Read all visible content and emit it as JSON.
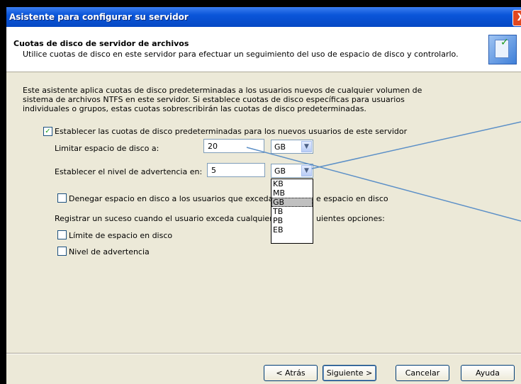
{
  "window": {
    "title": "Asistente para configurar su servidor",
    "close_label": "X"
  },
  "header": {
    "title": "Cuotas de disco de servidor de archivos",
    "subtitle": "Utilice cuotas de disco en este servidor para efectuar un seguimiento del uso de espacio de disco y controlarlo."
  },
  "intro": {
    "line1": "Este asistente aplica cuotas de disco predeterminadas a los usuarios nuevos de cualquier volumen de",
    "line2": "sistema de archivos NTFS en este servidor. Si establece cuotas de disco específicas para usuarios",
    "line3": "individuales o grupos, estas cuotas sobrescribirán las cuotas de disco predeterminadas."
  },
  "set_default_checkbox": {
    "label": "Establecer las cuotas de disco predeterminadas para los nuevos usuarios de este servidor",
    "checked": true
  },
  "limit": {
    "label": "Limitar espacio de disco a:",
    "value": "20",
    "unit": "GB"
  },
  "warning": {
    "label": "Establecer el nivel de advertencia en:",
    "value": "5",
    "unit": "GB"
  },
  "unit_options": [
    "KB",
    "MB",
    "GB",
    "TB",
    "PB",
    "EB"
  ],
  "deny_checkbox": {
    "label_before": "Denegar espacio en disco a los usuarios que excedan",
    "label_after": "e espacio en disco",
    "checked": false
  },
  "log": {
    "label_before": "Registrar un suceso cuando el usuario exceda cualquiera",
    "label_after": "uientes opciones:",
    "limit_label": "Límite de espacio en disco",
    "warning_label": "Nivel de advertencia"
  },
  "buttons": {
    "back": "< Atrás",
    "next": "Siguiente >",
    "cancel": "Cancelar",
    "help": "Ayuda"
  },
  "colors": {
    "titlebar": "#0a55d9",
    "dialog_bg": "#ece9d8",
    "annotation_line": "#5b8fc7"
  }
}
